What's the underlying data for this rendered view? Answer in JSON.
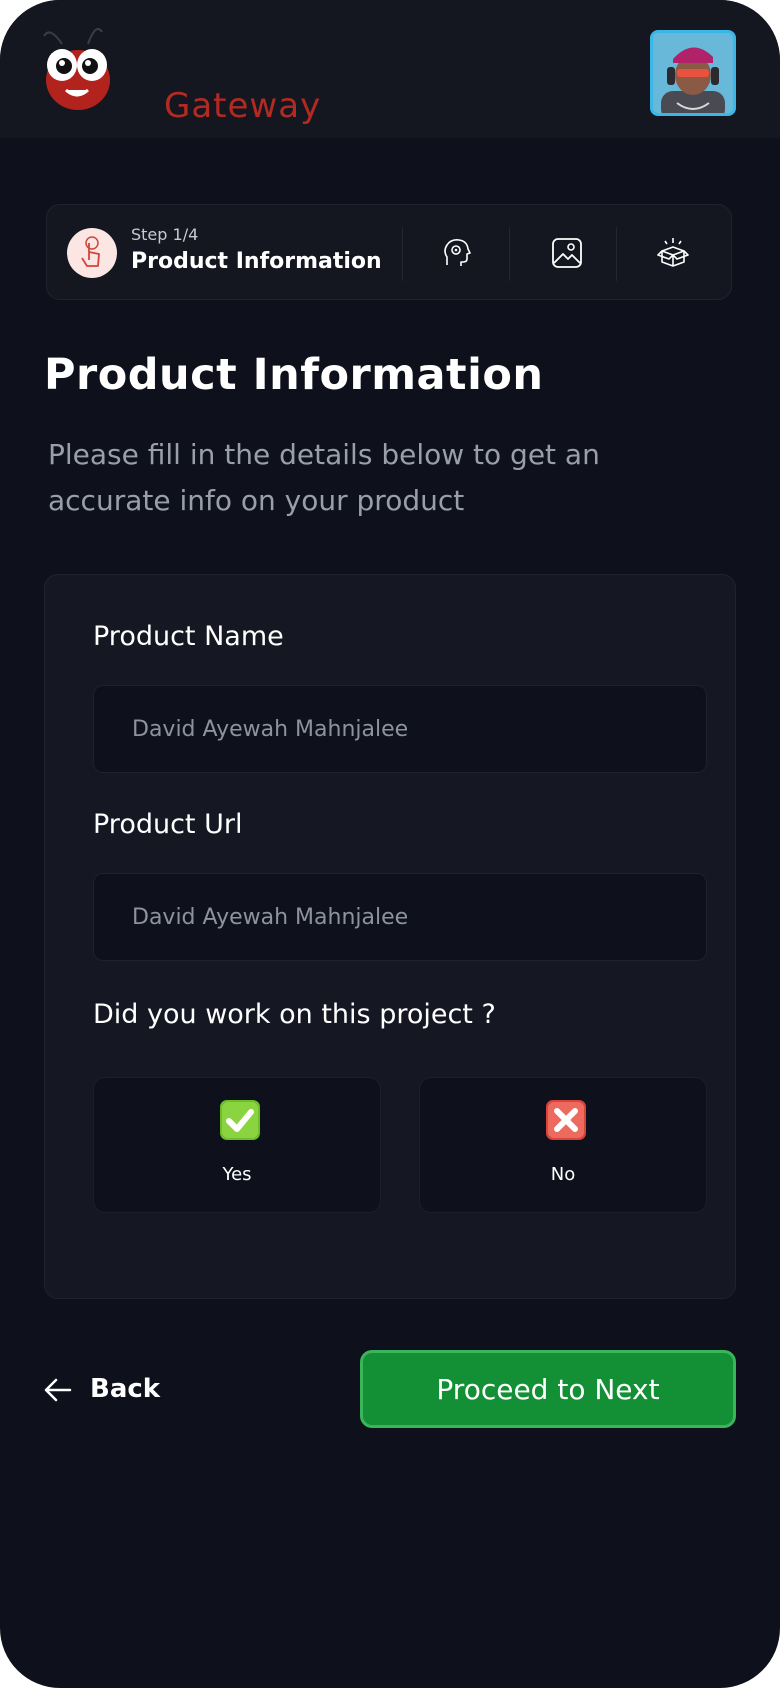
{
  "app": {
    "logo_text": "Gateway",
    "avatar_alt": "avatar"
  },
  "stepper": {
    "step_indicator": "Step 1/4",
    "current_step_title": "Product Information",
    "icons": [
      "hand-pointer-icon",
      "brain-gear-icon",
      "image-icon",
      "open-box-icon"
    ]
  },
  "page": {
    "title": "Product Information",
    "subtitle": "Please fill in the details below to get an accurate info on your product"
  },
  "form": {
    "product_name": {
      "label": "Product Name",
      "placeholder": "David Ayewah Mahnjalee"
    },
    "product_url": {
      "label": "Product Url",
      "placeholder": "David Ayewah Mahnjalee"
    },
    "work_question": "Did you work on this project ?",
    "choices": [
      {
        "label": "Yes",
        "icon": "green-check-icon"
      },
      {
        "label": "No",
        "icon": "red-x-icon"
      }
    ]
  },
  "actions": {
    "back_label": "Back",
    "next_label": "Proceed to Next"
  },
  "colors": {
    "background": "#0e111b",
    "surface": "#141720",
    "brand_red": "#b32a22",
    "accent_green": "#138f35",
    "accent_green_border": "#3bb55a",
    "avatar_border": "#3ab7e6"
  }
}
